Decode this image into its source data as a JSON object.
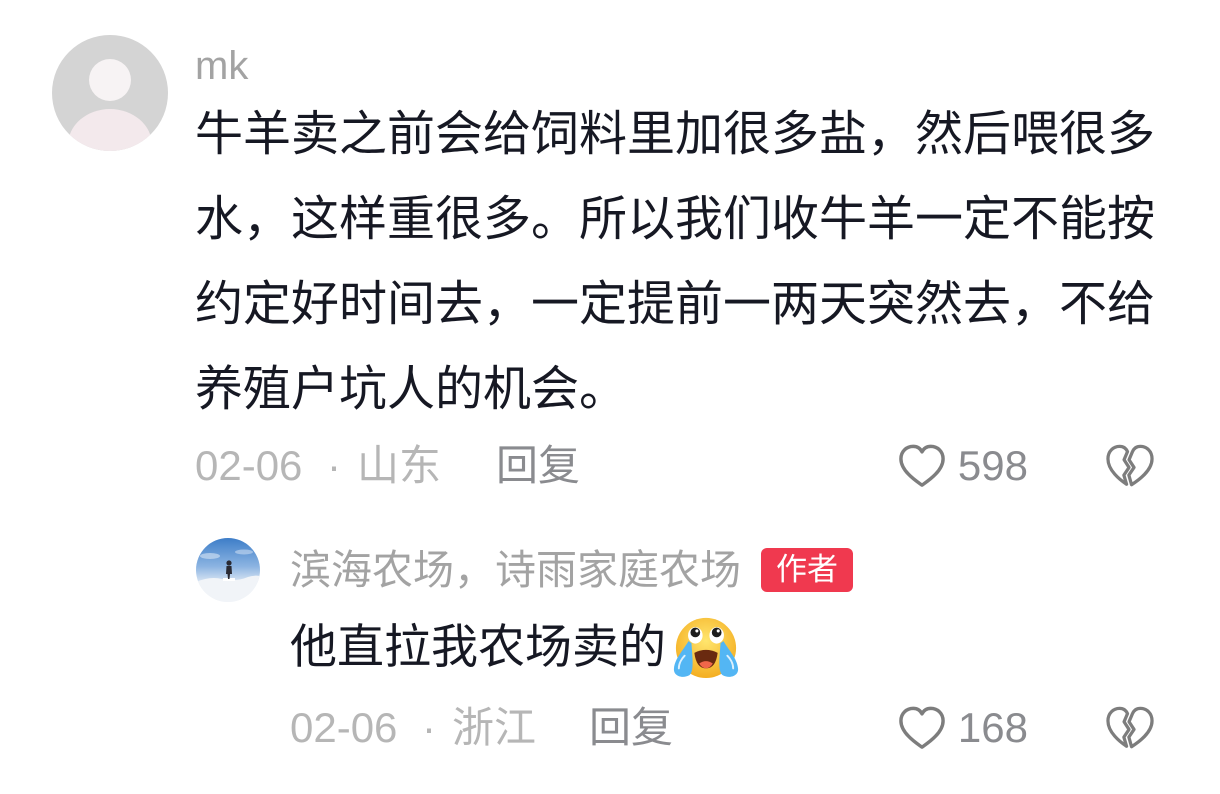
{
  "colors": {
    "background": "#ffffff",
    "text_primary": "#161823",
    "username": "#a3a3a3",
    "meta": "#b6b6b6",
    "action": "#8a8b8f",
    "icon": "#7d7d7d",
    "badge_bg": "#f0394f",
    "badge_text": "#ffffff"
  },
  "comment": {
    "avatar_icon": "default-user-avatar",
    "username": "mk",
    "text": "牛羊卖之前会给饲料里加很多盐，然后喂很多水，这样重很多。所以我们收牛羊一定不能按约定好时间去，一定提前一两天突然去，不给养殖户坑人的机会。",
    "date": "02-06",
    "separator": "·",
    "location": "山东",
    "reply_label": "回复",
    "like_icon": "heart-outline-icon",
    "like_count": "598",
    "dislike_icon": "broken-heart-icon"
  },
  "reply": {
    "avatar_icon": "user-avatar-photo",
    "username": "滨海农场，诗雨家庭农场",
    "badge": "作者",
    "text": "他直拉我农场卖的",
    "emoji_icon": "crying-face-emoji",
    "date": "02-06",
    "separator": "·",
    "location": "浙江",
    "reply_label": "回复",
    "like_icon": "heart-outline-icon",
    "like_count": "168",
    "dislike_icon": "broken-heart-icon"
  }
}
